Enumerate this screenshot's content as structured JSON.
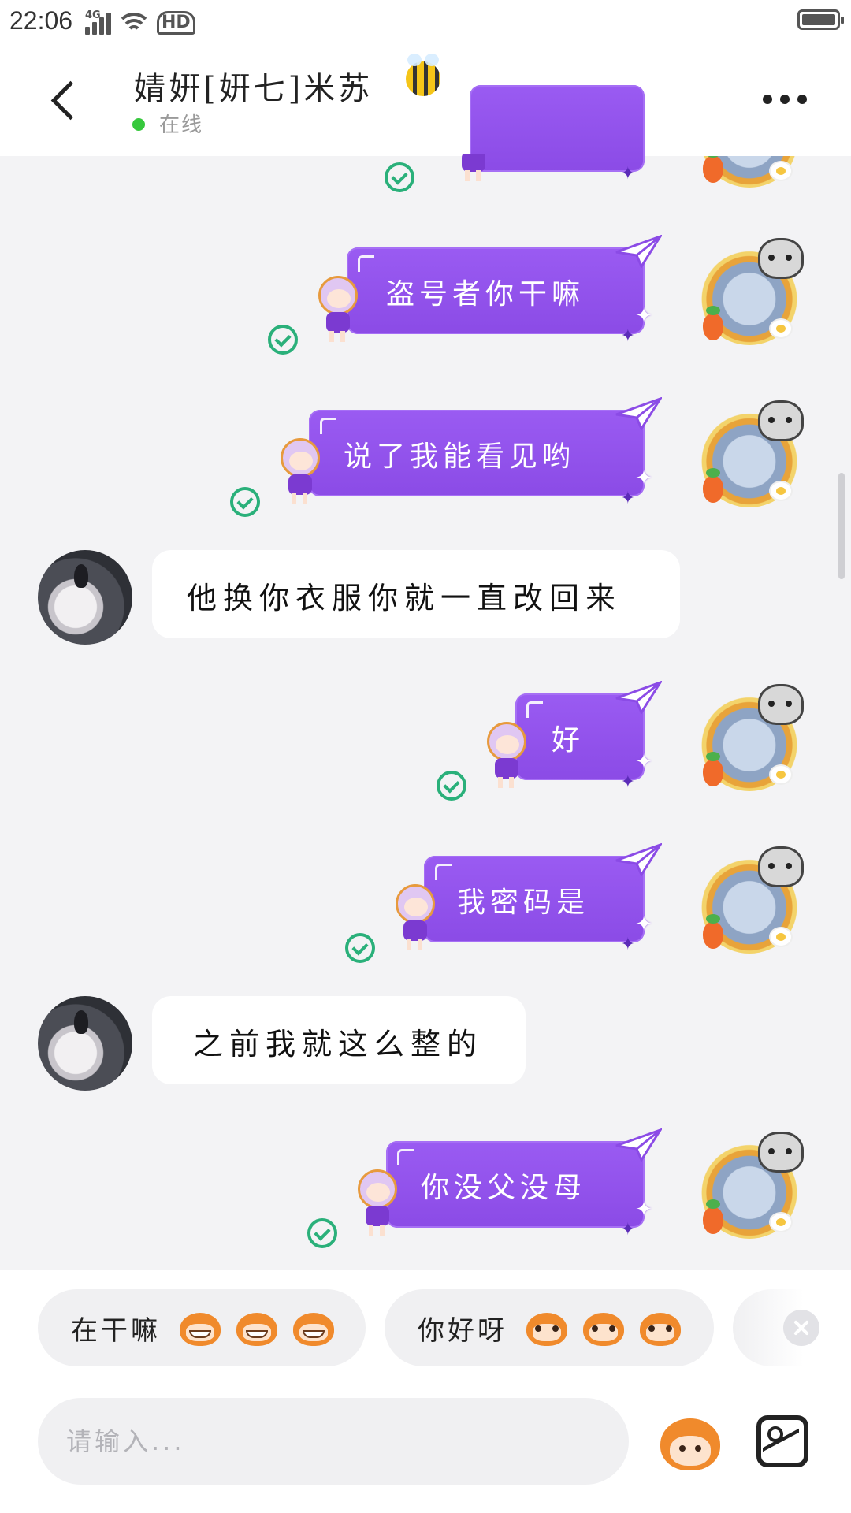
{
  "status_bar": {
    "time": "22:06",
    "network": "4G",
    "hd": "HD"
  },
  "header": {
    "title": "婧姸[姸七]米苏",
    "status": "在线"
  },
  "messages": [
    {
      "side": "out",
      "text": "",
      "partial": true
    },
    {
      "side": "out",
      "text": "盗号者你干嘛"
    },
    {
      "side": "out",
      "text": "说了我能看见哟"
    },
    {
      "side": "in",
      "text": "他换你衣服你就一直改回来"
    },
    {
      "side": "out",
      "text": "好"
    },
    {
      "side": "out",
      "text": "我密码是"
    },
    {
      "side": "in",
      "text": "之前我就这么整的"
    },
    {
      "side": "out",
      "text": "你没父没母"
    }
  ],
  "quick_replies": [
    {
      "text": "在干嘛",
      "emoji": "grin-monkey-icon"
    },
    {
      "text": "你好呀",
      "emoji": "smile-monkey-icon"
    }
  ],
  "input": {
    "placeholder": "请输入..."
  },
  "colors": {
    "bubble_purple": "#8b4be6",
    "check_green": "#2ab07a",
    "online_green": "#37c83d"
  }
}
